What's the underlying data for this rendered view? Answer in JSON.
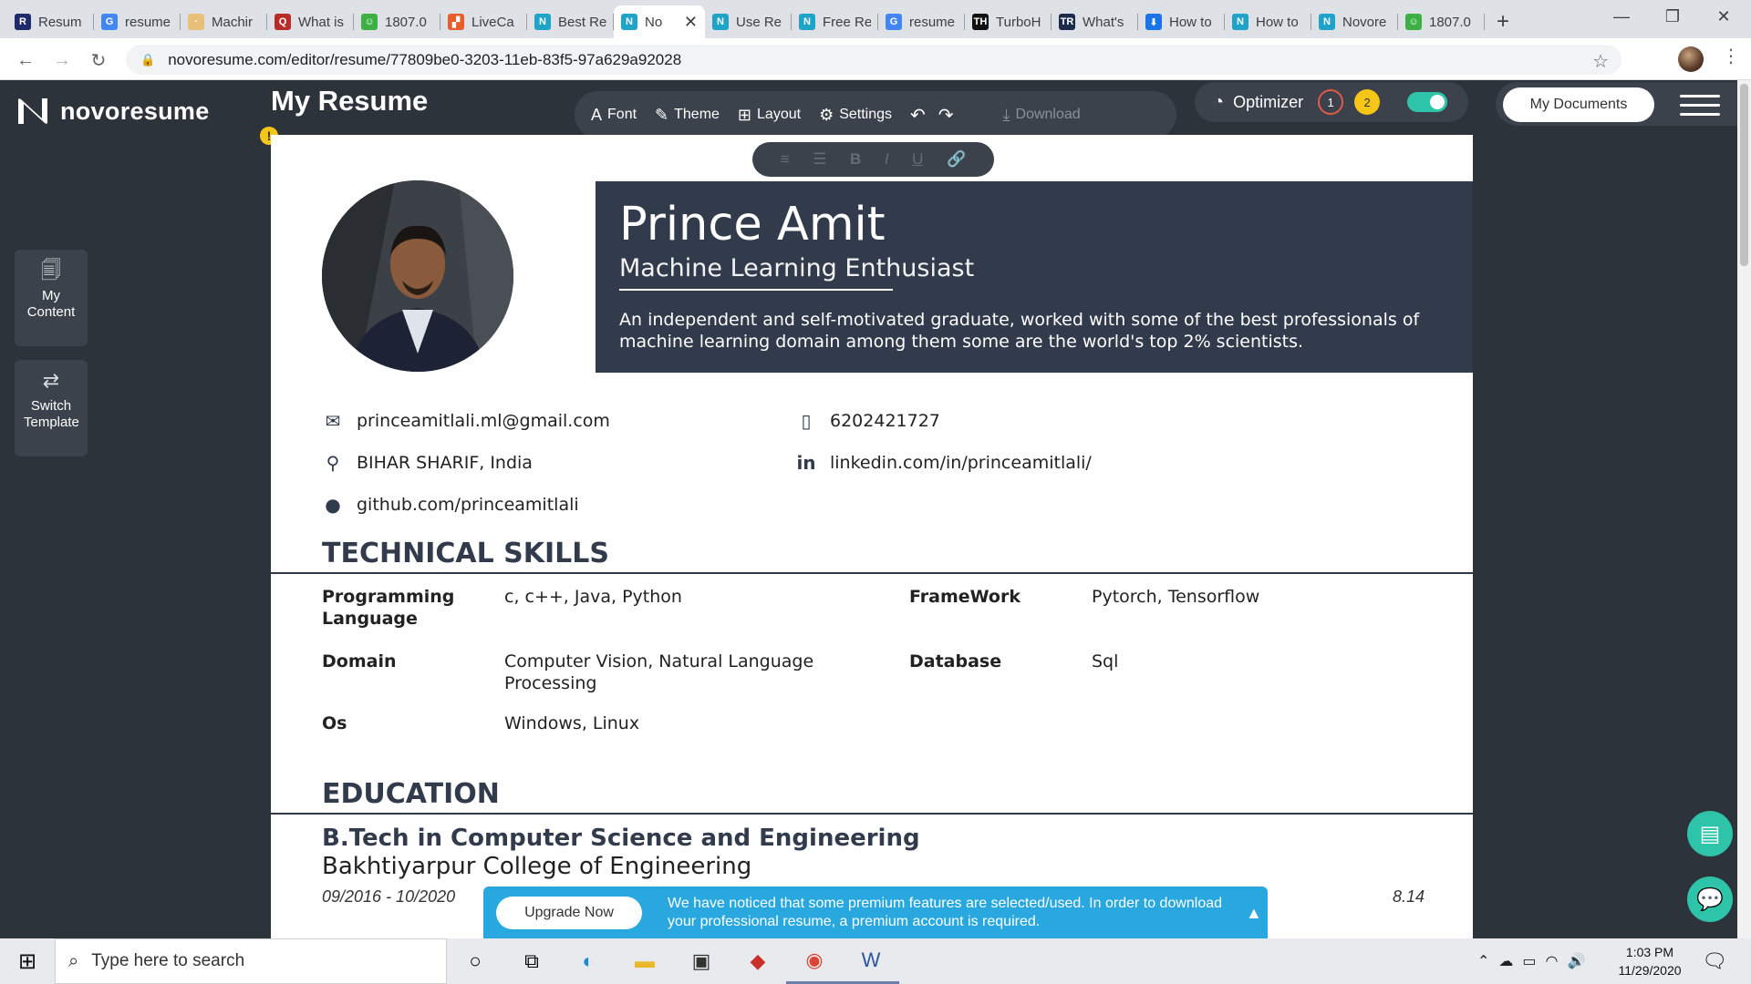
{
  "browser": {
    "tabs": [
      {
        "label": "Resum",
        "icon": "resume-io-icon",
        "icon_text": "R",
        "icon_color": "#1e2a6b",
        "active": false
      },
      {
        "label": "resume",
        "icon": "google-icon",
        "icon_text": "G",
        "icon_color": "#4285f4",
        "active": false
      },
      {
        "label": "Machir",
        "icon": "dotted-icon",
        "icon_text": "·",
        "icon_color": "#e8c07a",
        "active": false
      },
      {
        "label": "What is",
        "icon": "quora-icon",
        "icon_text": "Q",
        "icon_color": "#b92b27",
        "active": false
      },
      {
        "label": "1807.0",
        "icon": "smiley-icon",
        "icon_text": "☺",
        "icon_color": "#3cb043",
        "active": false
      },
      {
        "label": "LiveCa",
        "icon": "livecareer-icon",
        "icon_text": "▞",
        "icon_color": "#e85d2a",
        "active": false
      },
      {
        "label": "Best Re",
        "icon": "novoresume-icon",
        "icon_text": "N",
        "icon_color": "#1fa3c9",
        "active": false
      },
      {
        "label": "No",
        "icon": "novoresume-icon",
        "icon_text": "N",
        "icon_color": "#1fa3c9",
        "active": true
      },
      {
        "label": "Use Re",
        "icon": "novoresume-icon",
        "icon_text": "N",
        "icon_color": "#1fa3c9",
        "active": false
      },
      {
        "label": "Free Re",
        "icon": "novoresume-icon",
        "icon_text": "N",
        "icon_color": "#1fa3c9",
        "active": false
      },
      {
        "label": "resume",
        "icon": "google-icon",
        "icon_text": "G",
        "icon_color": "#4285f4",
        "active": false
      },
      {
        "label": "TurboH",
        "icon": "turbohire-icon",
        "icon_text": "TH",
        "icon_color": "#111111",
        "active": false
      },
      {
        "label": "What's",
        "icon": "tr-icon",
        "icon_text": "TR",
        "icon_color": "#1c2b4a",
        "active": false
      },
      {
        "label": "How to",
        "icon": "bookmark-blue-icon",
        "icon_text": "⬇",
        "icon_color": "#1a73e8",
        "active": false
      },
      {
        "label": "How to",
        "icon": "novoresume-icon",
        "icon_text": "N",
        "icon_color": "#1fa3c9",
        "active": false
      },
      {
        "label": "Novore",
        "icon": "novoresume-icon",
        "icon_text": "N",
        "icon_color": "#1fa3c9",
        "active": false
      },
      {
        "label": "1807.0",
        "icon": "smiley-icon",
        "icon_text": "☺",
        "icon_color": "#3cb043",
        "active": false
      }
    ],
    "url": "novoresume.com/editor/resume/77809be0-3203-11eb-83f5-97a629a92028"
  },
  "app": {
    "logo_text": "novoresume",
    "doc_title": "My Resume",
    "toolbar": {
      "font": "Font",
      "theme": "Theme",
      "layout": "Layout",
      "settings": "Settings",
      "download": "Download"
    },
    "optimizer": {
      "label": "Optimizer",
      "badge1": "1",
      "badge2": "2"
    },
    "my_documents": "My Documents",
    "sidebar": [
      {
        "label": "My Content",
        "icon": "my-content-icon"
      },
      {
        "label": "Switch Template",
        "icon": "switch-template-icon"
      }
    ],
    "accent_color": "#2ec4a9",
    "warning_color": "#f5c518"
  },
  "resume": {
    "name": "Prince Amit",
    "role": "Machine Learning Enthusiast",
    "summary": "An independent and self-motivated graduate, worked with some of the best professionals of machine learning domain among them some are the world's top 2% scientists.",
    "contacts": {
      "email": "princeamitlali.ml@gmail.com",
      "phone": "6202421727",
      "location": "BIHAR SHARIF, India",
      "linkedin": "linkedin.com/in/princeamitlali/",
      "github": "github.com/princeamitlali"
    },
    "header_color": "#323b4c",
    "sections": {
      "skills_title": "TECHNICAL SKILLS",
      "education_title": "EDUCATION"
    },
    "skills": [
      {
        "label": "Programming Language",
        "value": "c, c++, Java, Python"
      },
      {
        "label": "FrameWork",
        "value": "Pytorch, Tensorflow"
      },
      {
        "label": "Domain",
        "value": "Computer Vision, Natural Language Processing"
      },
      {
        "label": "Database",
        "value": "Sql"
      },
      {
        "label": "Os",
        "value": "Windows, Linux"
      }
    ],
    "education": {
      "degree": "B.Tech in Computer Science and Engineering",
      "school": "Bakhtiyarpur College of Engineering",
      "dates": "09/2016 - 10/2020",
      "gpa": "8.14"
    }
  },
  "premium_banner": {
    "button": "Upgrade Now",
    "message": "We have noticed that some premium features are selected/used. In order to download your professional resume, a premium account is required."
  },
  "taskbar": {
    "search_placeholder": "Type here to search",
    "time": "1:03 PM",
    "date": "11/29/2020"
  }
}
